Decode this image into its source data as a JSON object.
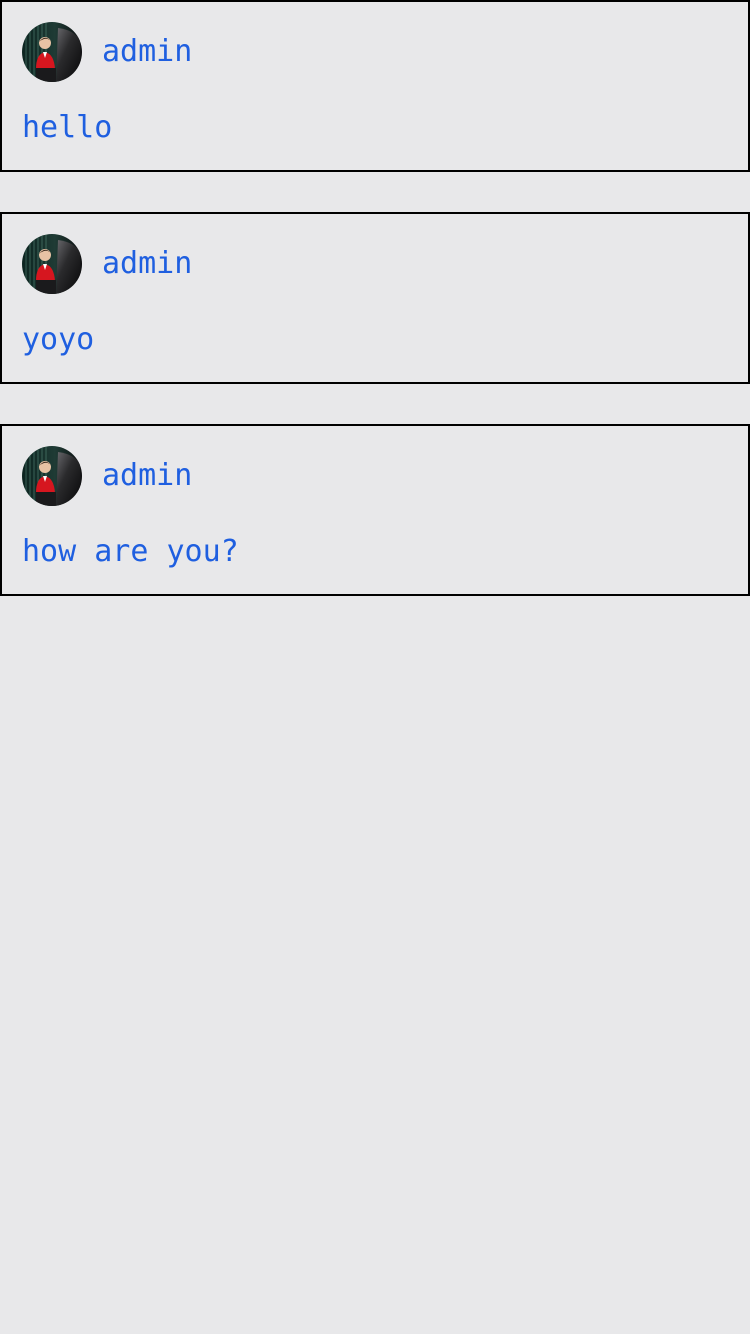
{
  "colors": {
    "background": "#e8e8ea",
    "card_border": "#000000",
    "text_accent": "#1f5fe0"
  },
  "posts": [
    {
      "avatar_icon": "user-avatar-photo",
      "username": "admin",
      "message": "hello"
    },
    {
      "avatar_icon": "user-avatar-photo",
      "username": "admin",
      "message": "yoyo"
    },
    {
      "avatar_icon": "user-avatar-photo",
      "username": "admin",
      "message": "how are you?"
    }
  ]
}
